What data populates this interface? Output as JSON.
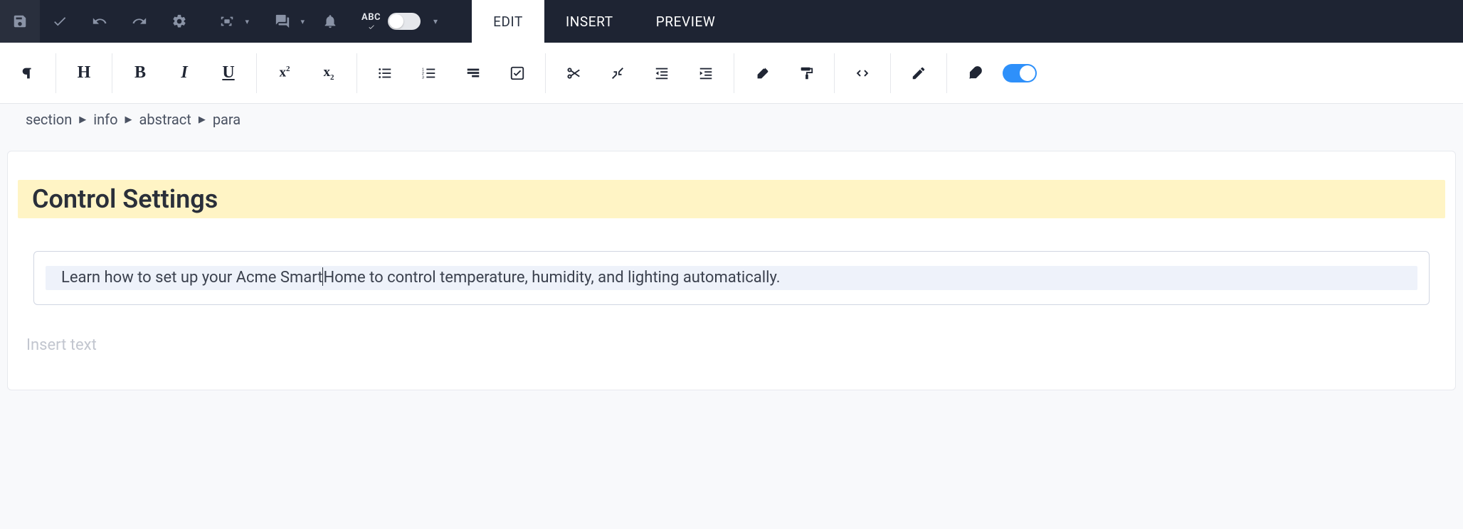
{
  "topToolbar": {
    "abcLabel": "ABC"
  },
  "tabs": [
    {
      "label": "EDIT",
      "active": true
    },
    {
      "label": "INSERT",
      "active": false
    },
    {
      "label": "PREVIEW",
      "active": false
    }
  ],
  "formatting": {
    "heading": "H",
    "bold": "B",
    "italic": "I",
    "underline": "U",
    "superscript_base": "x",
    "superscript_exp": "2",
    "subscript_base": "x",
    "subscript_exp": "2"
  },
  "breadcrumb": [
    "section",
    "info",
    "abstract",
    "para"
  ],
  "editor": {
    "title": "Control Settings",
    "paragraph_before": "Learn how to set up your Acme Smart",
    "paragraph_after": "Home to control temperature, humidity, and lighting automatically.",
    "placeholder": "Insert text"
  }
}
